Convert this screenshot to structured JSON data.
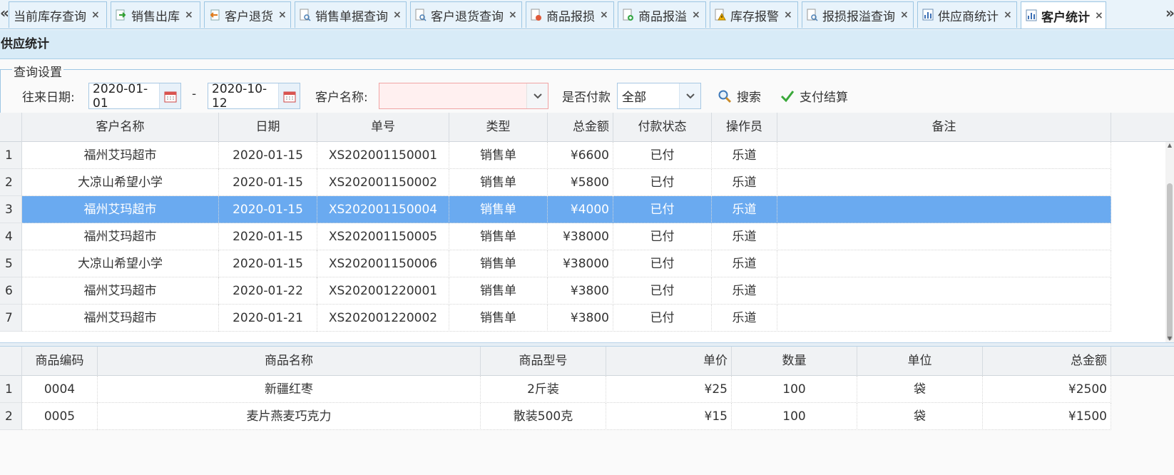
{
  "tabs": [
    {
      "label": "当前库存查询",
      "icon": "page-icon",
      "active": false
    },
    {
      "label": "销售出库",
      "icon": "export-icon",
      "active": false
    },
    {
      "label": "客户退货",
      "icon": "return-icon",
      "active": false
    },
    {
      "label": "销售单据查询",
      "icon": "search-doc-icon",
      "active": false
    },
    {
      "label": "客户退货查询",
      "icon": "search-doc-icon",
      "active": false
    },
    {
      "label": "商品报损",
      "icon": "damage-icon",
      "active": false
    },
    {
      "label": "商品报溢",
      "icon": "overflow-icon",
      "active": false
    },
    {
      "label": "库存报警",
      "icon": "warning-icon",
      "active": false
    },
    {
      "label": "报损报溢查询",
      "icon": "search-doc-icon",
      "active": false
    },
    {
      "label": "供应商统计",
      "icon": "chart-icon",
      "active": false
    },
    {
      "label": "客户统计",
      "icon": "chart-icon",
      "active": true
    }
  ],
  "tab_close_glyph": "×",
  "tab_scroll_left": "«",
  "tab_scroll_right": "»",
  "panel_title": "供应统计",
  "query": {
    "legend": "查询设置",
    "date_label": "往来日期:",
    "date_from": "2020-01-01",
    "date_sep": "-",
    "date_to": "2020-10-12",
    "customer_label": "客户名称:",
    "customer_value": "",
    "paid_label": "是否付款",
    "paid_value": "全部",
    "search_label": "搜索",
    "settle_label": "支付结算"
  },
  "main_grid": {
    "columns": [
      "客户名称",
      "日期",
      "单号",
      "类型",
      "总金额",
      "付款状态",
      "操作员",
      "备注"
    ],
    "selected_row": 2,
    "rows": [
      {
        "num": "1",
        "customer": "福州艾玛超市",
        "date": "2020-01-15",
        "no": "XS202001150001",
        "type": "销售单",
        "amount": "¥6600",
        "status": "已付",
        "operator": "乐道",
        "note": ""
      },
      {
        "num": "2",
        "customer": "大凉山希望小学",
        "date": "2020-01-15",
        "no": "XS202001150002",
        "type": "销售单",
        "amount": "¥5800",
        "status": "已付",
        "operator": "乐道",
        "note": ""
      },
      {
        "num": "3",
        "customer": "福州艾玛超市",
        "date": "2020-01-15",
        "no": "XS202001150004",
        "type": "销售单",
        "amount": "¥4000",
        "status": "已付",
        "operator": "乐道",
        "note": ""
      },
      {
        "num": "4",
        "customer": "福州艾玛超市",
        "date": "2020-01-15",
        "no": "XS202001150005",
        "type": "销售单",
        "amount": "¥38000",
        "status": "已付",
        "operator": "乐道",
        "note": ""
      },
      {
        "num": "5",
        "customer": "大凉山希望小学",
        "date": "2020-01-15",
        "no": "XS202001150006",
        "type": "销售单",
        "amount": "¥38000",
        "status": "已付",
        "operator": "乐道",
        "note": ""
      },
      {
        "num": "6",
        "customer": "福州艾玛超市",
        "date": "2020-01-22",
        "no": "XS202001220001",
        "type": "销售单",
        "amount": "¥3800",
        "status": "已付",
        "operator": "乐道",
        "note": ""
      },
      {
        "num": "7",
        "customer": "福州艾玛超市",
        "date": "2020-01-21",
        "no": "XS202001220002",
        "type": "销售单",
        "amount": "¥3800",
        "status": "已付",
        "operator": "乐道",
        "note": ""
      }
    ]
  },
  "detail_grid": {
    "columns": [
      "商品编码",
      "商品名称",
      "商品型号",
      "单价",
      "数量",
      "单位",
      "总金额"
    ],
    "rows": [
      {
        "num": "1",
        "code": "0004",
        "name": "新疆红枣",
        "model": "2斤装",
        "price": "¥25",
        "qty": "100",
        "unit": "袋",
        "total": "¥2500"
      },
      {
        "num": "2",
        "code": "0005",
        "name": "麦片燕麦巧克力",
        "model": "散装500克",
        "price": "¥15",
        "qty": "100",
        "unit": "袋",
        "total": "¥1500"
      }
    ]
  },
  "colors": {
    "selected_row": "#6aaaf0",
    "header_bg": "#d8ebf7",
    "tab_border": "#9dc6e3",
    "invalid_field_bg": "#fff0f0"
  }
}
